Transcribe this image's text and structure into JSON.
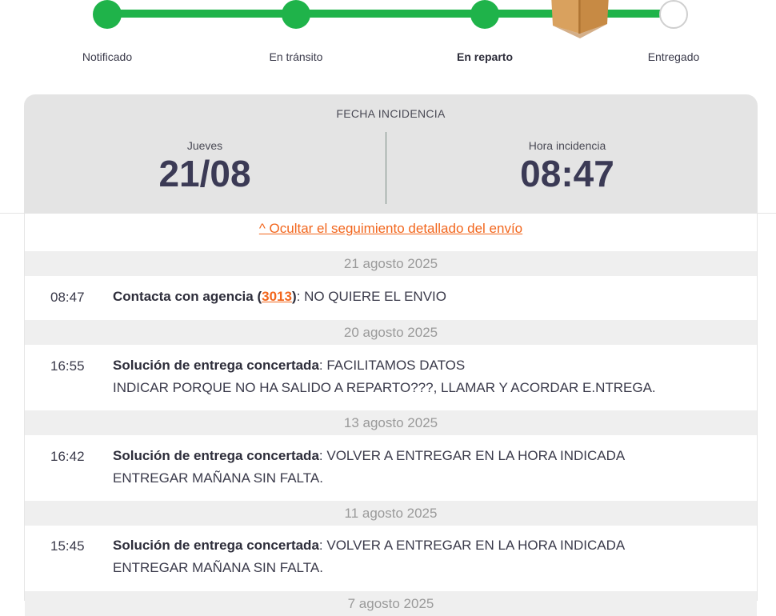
{
  "tracker": {
    "steps": [
      {
        "label": "Notificado",
        "state": "done"
      },
      {
        "label": "En tránsito",
        "state": "done"
      },
      {
        "label": "En reparto",
        "state": "current"
      },
      {
        "label": "Entregado",
        "state": "pending"
      }
    ],
    "current_icon": "package-box-icon"
  },
  "incident": {
    "title": "FECHA INCIDENCIA",
    "day_label": "Jueves",
    "date": "21/08",
    "time_label": "Hora incidencia",
    "time": "08:47"
  },
  "detail": {
    "toggle_label": "^ Ocultar el seguimiento detallado del envío",
    "groups": [
      {
        "date": "21 agosto 2025",
        "events": [
          {
            "time": "08:47",
            "title": "Contacta con agencia",
            "agency_open": " (",
            "agency_code": "3013",
            "agency_close": ")",
            "separator": ": ",
            "lines": [
              "NO QUIERE EL ENVIO"
            ]
          }
        ]
      },
      {
        "date": "20 agosto 2025",
        "events": [
          {
            "time": "16:55",
            "title": "Solución de entrega concertada",
            "separator": ": ",
            "lines": [
              "FACILITAMOS DATOS",
              "INDICAR PORQUE NO HA SALIDO A REPARTO???, LLAMAR Y ACORDAR E.NTREGA."
            ]
          }
        ]
      },
      {
        "date": "13 agosto 2025",
        "events": [
          {
            "time": "16:42",
            "title": "Solución de entrega concertada",
            "separator": ": ",
            "lines": [
              "VOLVER A ENTREGAR EN LA HORA INDICADA",
              "ENTREGAR MAÑANA SIN FALTA."
            ]
          }
        ]
      },
      {
        "date": "11 agosto 2025",
        "events": [
          {
            "time": "15:45",
            "title": "Solución de entrega concertada",
            "separator": ": ",
            "lines": [
              "VOLVER A ENTREGAR EN LA HORA INDICADA",
              "ENTREGAR MAÑANA SIN FALTA."
            ]
          }
        ]
      },
      {
        "date": "7 agosto 2025",
        "events": []
      }
    ]
  },
  "colors": {
    "progress_green": "#1fb34a",
    "link_orange": "#f2661d",
    "card_bg": "#e4e4e4",
    "band_bg": "#efefef",
    "heading_dark": "#3b3a55"
  }
}
